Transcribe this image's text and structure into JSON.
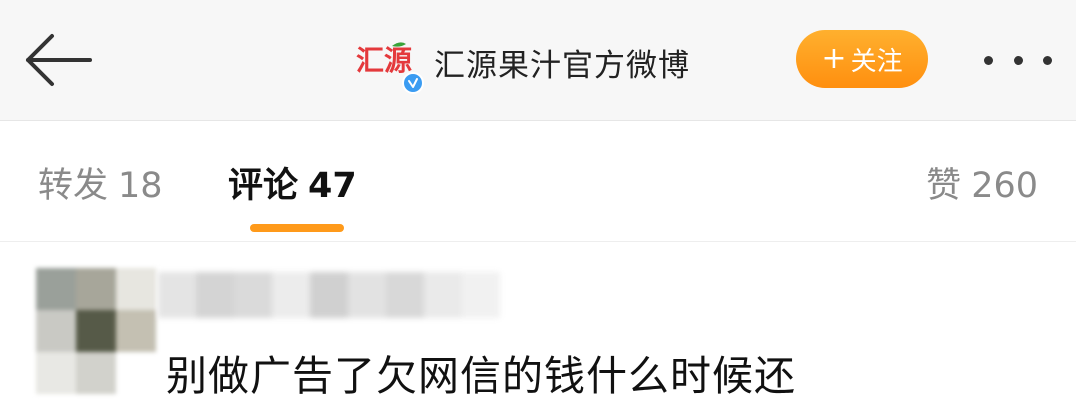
{
  "header": {
    "back_icon": "arrow-left-icon",
    "account": {
      "logo_text": "汇源",
      "name": "汇源果汁官方微博",
      "verified_icon": "verified-badge-icon"
    },
    "follow_button": {
      "label": "关注",
      "icon": "plus-icon"
    },
    "more_icon": "more-dots-icon"
  },
  "tabs": [
    {
      "label": "转发",
      "count": "18",
      "active": false
    },
    {
      "label": "评论",
      "count": "47",
      "active": true
    },
    {
      "label": "赞",
      "count": "260",
      "active": false
    }
  ],
  "comment": {
    "text": "别做广告了欠网信的钱什么时候还"
  },
  "colors": {
    "accent_orange": "#ff9a1a",
    "brand_red": "#e4393c",
    "brand_green": "#3aa33a",
    "verified_blue": "#3b9cf2"
  }
}
